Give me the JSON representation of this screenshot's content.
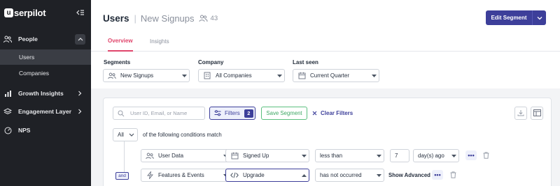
{
  "app": {
    "logo_letter": "u",
    "logo_text": "serpilot"
  },
  "sidebar": {
    "items": [
      {
        "label": "People",
        "icon": "people-icon"
      },
      {
        "label": "Users"
      },
      {
        "label": "Companies"
      },
      {
        "label": "Growth Insights",
        "icon": "bar-chart-icon"
      },
      {
        "label": "Engagement Layer",
        "icon": "layers-icon"
      },
      {
        "label": "NPS",
        "icon": "gauge-icon"
      }
    ]
  },
  "header": {
    "title": "Users",
    "segment": "New Signups",
    "count": "43",
    "edit_label": "Edit Segment"
  },
  "tabs": [
    {
      "label": "Overview",
      "active": true
    },
    {
      "label": "Insights",
      "active": false
    }
  ],
  "fields": {
    "segments": {
      "label": "Segments",
      "value": "New Signups"
    },
    "company": {
      "label": "Company",
      "value": "All Companies"
    },
    "last_seen": {
      "label": "Last seen",
      "value": "Current Quarter"
    }
  },
  "filter_bar": {
    "search_placeholder": "User ID, Email, or Name",
    "filters_label": "Filters",
    "filters_count": "2",
    "save_label": "Save Segment",
    "clear_label": "Clear Filters"
  },
  "conditions": {
    "match_value": "All",
    "match_text": "of the following conditions match",
    "rows": [
      {
        "source": "User Data",
        "field": "Signed Up",
        "operator": "less than",
        "number": "7",
        "unit": "day(s) ago"
      },
      {
        "connector": "and",
        "source": "Features & Events",
        "field": "Upgrade",
        "operator": "has not occurred",
        "link": "Show Advanced"
      }
    ]
  },
  "colors": {
    "accent": "#3d3f9a",
    "tab_active": "#e0456b",
    "sidebar_bg": "#1f2126",
    "save_green": "#3fa765"
  }
}
